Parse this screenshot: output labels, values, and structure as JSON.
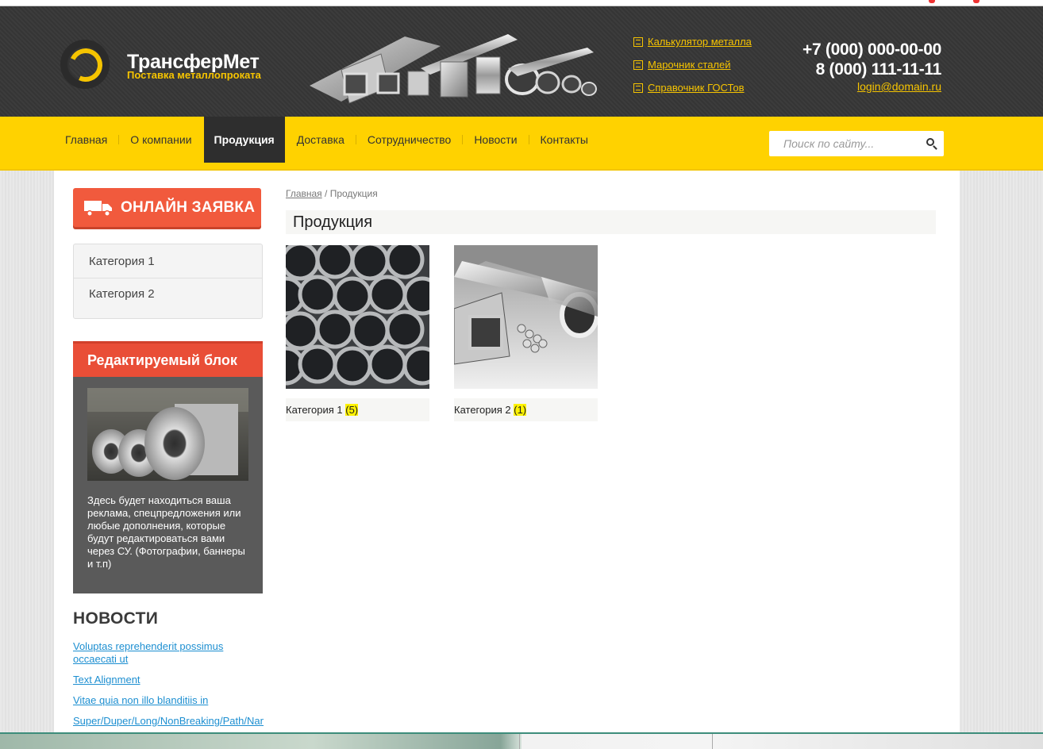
{
  "site": {
    "name": "ТрансферМет",
    "tagline": "Поставка металлопроката"
  },
  "header_links": [
    {
      "icon": "calculator-icon",
      "label": "Калькулятор металла"
    },
    {
      "icon": "book-icon",
      "label": "Марочник сталей"
    },
    {
      "icon": "list-icon",
      "label": "Справочник ГОСТов"
    }
  ],
  "contacts": {
    "phone1": "+7 (000) 000-00-00",
    "phone2": "8 (000) 111-11-11",
    "email": "login@domain.ru"
  },
  "nav": {
    "items": [
      "Главная",
      "О компании",
      "Продукция",
      "Доставка",
      "Сотрудничество",
      "Новости",
      "Контакты"
    ],
    "active": "Продукция"
  },
  "search": {
    "placeholder": "Поиск по сайту..."
  },
  "sidebar": {
    "order_button": "ОНЛАЙН ЗАЯВКА",
    "categories": [
      "Категория 1",
      "Категория 2"
    ],
    "block_title": "Редактируемый блок",
    "block_text": "Здесь будет находиться ваша реклама, спецпредложения или любые дополнения, которые будут редактироваться вами через СУ. (Фотографии, баннеры и т.п)",
    "news_title": "НОВОСТИ",
    "news": [
      "Voluptas reprehenderit possimus occaecati ut",
      "Text Alignment",
      "Vitae quia non illo blanditiis in",
      "Super/Duper/Long/NonBreaking/Path/Name"
    ]
  },
  "breadcrumb": {
    "home": "Главная",
    "separator": " / ",
    "current": "Продукция"
  },
  "page_title": "Продукция",
  "products": [
    {
      "name": "Категория 1",
      "count": "(5)"
    },
    {
      "name": "Категория 2",
      "count": "(1)"
    }
  ],
  "colors": {
    "accent_yellow": "#ffd200",
    "header_dark": "#3a3a3a",
    "order_red": "#f15a3d",
    "link_blue": "#1d8fd1"
  }
}
